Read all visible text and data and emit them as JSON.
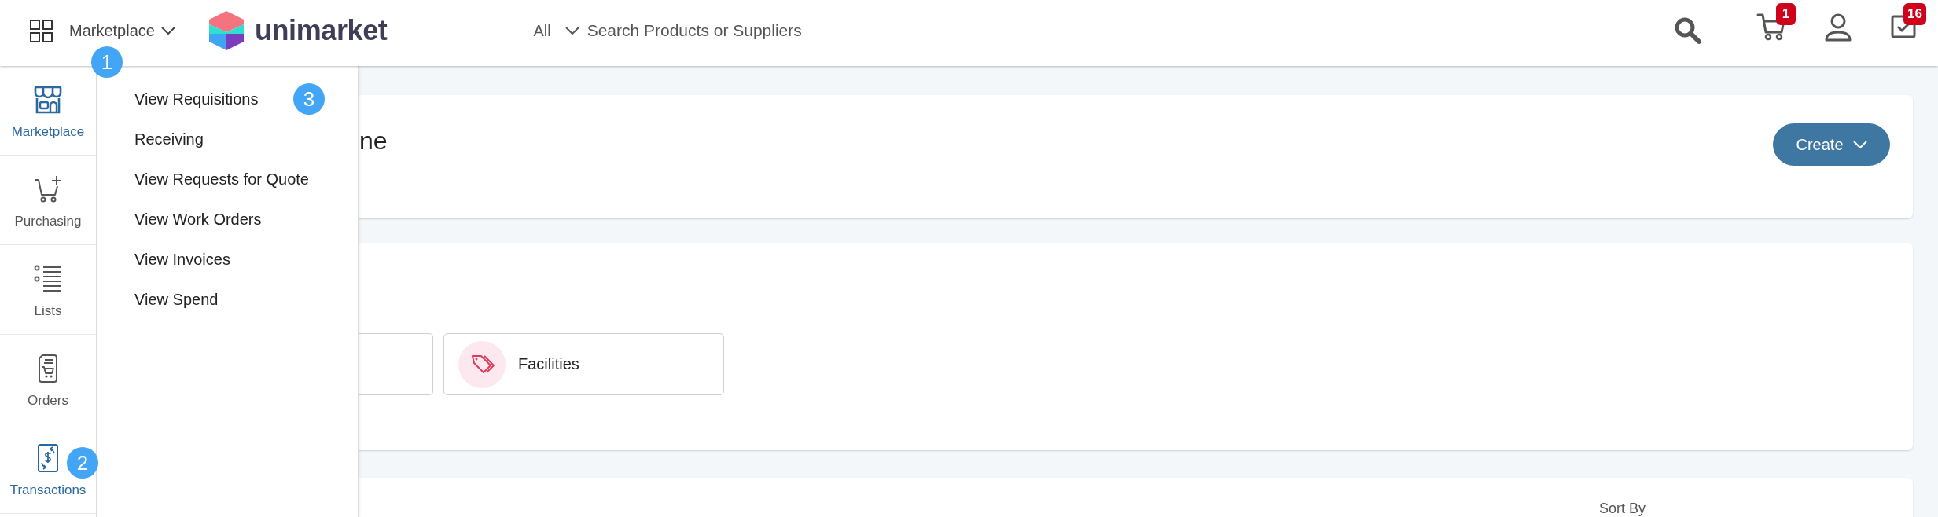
{
  "header": {
    "apps_menu": {
      "label": "Marketplace",
      "callout": "1"
    },
    "logo": {
      "text": "unimarket"
    },
    "search": {
      "scope": "All",
      "placeholder": "Search Products or Suppliers"
    },
    "actions": [
      {
        "kind": "search"
      },
      {
        "kind": "cart",
        "badge": "1"
      },
      {
        "kind": "account"
      },
      {
        "kind": "tasks",
        "badge": "16"
      }
    ]
  },
  "sidebar": {
    "items": [
      {
        "kind": "marketplace",
        "label": "Marketplace",
        "selected": true
      },
      {
        "kind": "purchasing",
        "label": "Purchasing",
        "selected": false
      },
      {
        "kind": "lists",
        "label": "Lists",
        "selected": false
      },
      {
        "kind": "orders",
        "label": "Orders",
        "selected": false
      },
      {
        "kind": "transactions",
        "label": "Transactions",
        "selected": true,
        "callout": "2"
      }
    ]
  },
  "flyout_menu": {
    "items": [
      {
        "label": "View Requisitions",
        "callout": "3"
      },
      {
        "label": "Receiving"
      },
      {
        "label": "View Requests for Quote"
      },
      {
        "label": "View Work Orders"
      },
      {
        "label": "View Invoices"
      },
      {
        "label": "View Spend"
      }
    ]
  },
  "page": {
    "heading": "ne",
    "create_button": {
      "label": "Create"
    }
  },
  "categories": [
    {
      "covered": true
    },
    {
      "covered": false,
      "label": "Facilities"
    }
  ],
  "list_panel": {
    "sort_label": "Sort By"
  }
}
